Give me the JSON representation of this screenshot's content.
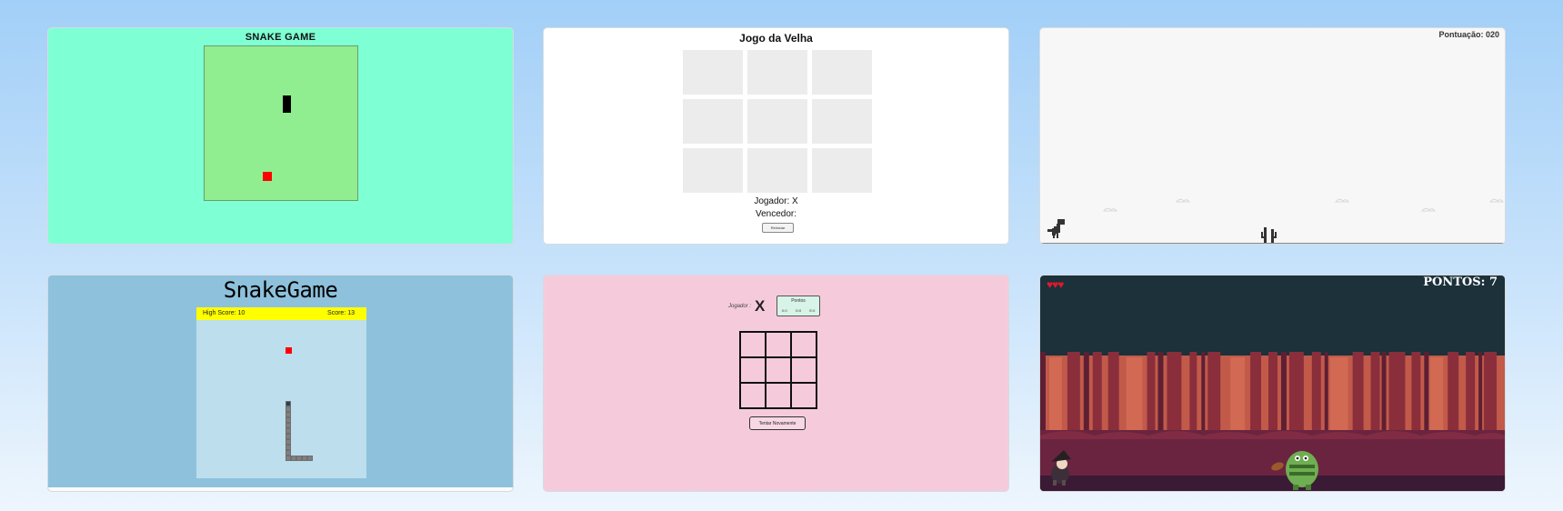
{
  "colors": {
    "page_bg": "#a2cff7",
    "snake1_bg": "#7fffd4",
    "snake1_board": "#90ee90",
    "snake2_bg": "#8ec1dc",
    "snake2_bar": "#ffff00",
    "tictactoe2_bg": "#f5cbdc",
    "ninja_bg": "#1c313a",
    "food": "#ff0000"
  },
  "cards": {
    "snake1": {
      "title": "SNAKE GAME"
    },
    "tictactoe1": {
      "title": "Jogo da Velha",
      "player": "Jogador: X",
      "winner": "Vencedor:",
      "button": "Reiniciar"
    },
    "dino": {
      "score": "Pontuação: 020"
    },
    "snake2": {
      "title": "SnakeGame",
      "high_score": "High Score: 10",
      "score": "Score: 13"
    },
    "tictactoe2": {
      "player_label": "Jogador :",
      "player_mark": "X",
      "points_title": "Pontos",
      "points_x": "X:0",
      "points_o": "O:0",
      "points_tie": "E:0",
      "button": "Tentar Novamente"
    },
    "ninja": {
      "hearts": "♥♥♥",
      "score": "PONTOS: 7"
    }
  }
}
